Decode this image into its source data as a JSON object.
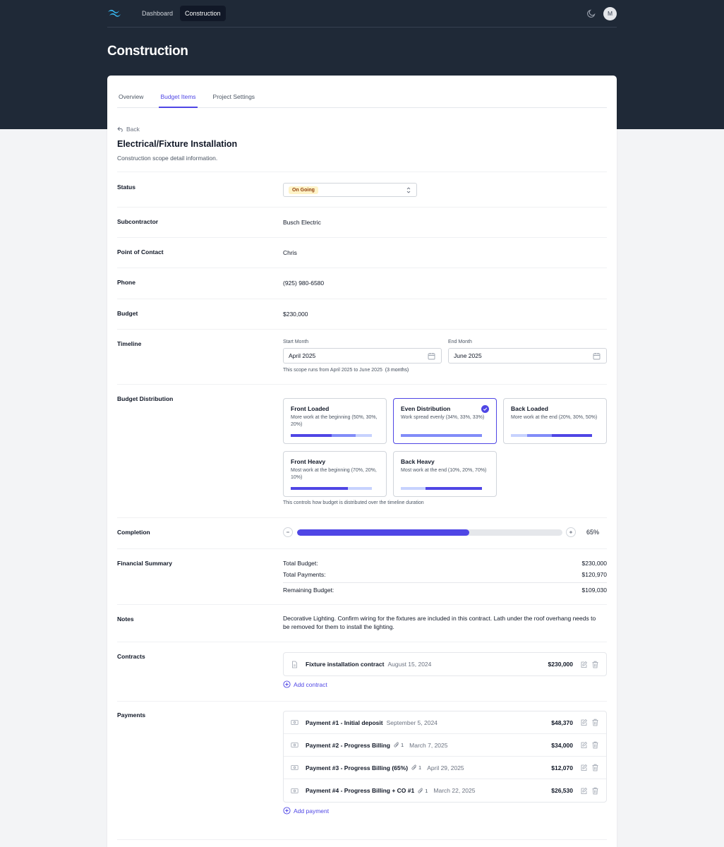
{
  "nav": {
    "links": [
      "Dashboard",
      "Construction"
    ],
    "avatar_initial": "M"
  },
  "page": {
    "title": "Construction"
  },
  "tabs": [
    "Overview",
    "Budget Items",
    "Project Settings"
  ],
  "detail": {
    "back_label": "Back",
    "title": "Electrical/Fixture Installation",
    "subtitle": "Construction scope detail information."
  },
  "fields": {
    "status": {
      "label": "Status",
      "value": "On Going"
    },
    "subcontractor": {
      "label": "Subcontractor",
      "value": "Busch Electric"
    },
    "contact": {
      "label": "Point of Contact",
      "value": "Chris"
    },
    "phone": {
      "label": "Phone",
      "value": "(925) 980-6580"
    },
    "budget": {
      "label": "Budget",
      "value": "$230,000"
    }
  },
  "timeline": {
    "label": "Timeline",
    "start_label": "Start Month",
    "start_value": "April 2025",
    "end_label": "End Month",
    "end_value": "June 2025",
    "hint_text": "This scope runs from April 2025 to June 2025",
    "hint_months": "(3 months)"
  },
  "distribution": {
    "label": "Budget Distribution",
    "hint": "This controls how budget is distributed over the timeline duration",
    "options": [
      {
        "title": "Front Loaded",
        "desc": "More work at the beginning (50%, 30%, 20%)",
        "split": [
          50,
          30,
          20
        ],
        "selected": false
      },
      {
        "title": "Even Distribution",
        "desc": "Work spread evenly (34%, 33%, 33%)",
        "split": [
          34,
          33,
          33
        ],
        "selected": true
      },
      {
        "title": "Back Loaded",
        "desc": "More work at the end (20%, 30%, 50%)",
        "split": [
          20,
          30,
          50
        ],
        "selected": false
      },
      {
        "title": "Front Heavy",
        "desc": "Most work at the beginning (70%, 20%, 10%)",
        "split": [
          70,
          20,
          10
        ],
        "selected": false
      },
      {
        "title": "Back Heavy",
        "desc": "Most work at the end (10%, 20%, 70%)",
        "split": [
          10,
          20,
          70
        ],
        "selected": false
      }
    ]
  },
  "completion": {
    "label": "Completion",
    "percent": 65,
    "percent_text": "65%"
  },
  "financial": {
    "label": "Financial Summary",
    "rows": [
      {
        "label": "Total Budget:",
        "value": "$230,000"
      },
      {
        "label": "Total Payments:",
        "value": "$120,970"
      },
      {
        "label": "Remaining Budget:",
        "value": "$109,030"
      }
    ]
  },
  "notes": {
    "label": "Notes",
    "text": "Decorative Lighting. Confirm wiring for the fixtures are included in this contract. Lath under the roof overhang needs to be removed for them to install the lighting."
  },
  "contracts": {
    "label": "Contracts",
    "items": [
      {
        "name": "Fixture installation contract",
        "date": "August 15, 2024",
        "amount": "$230,000"
      }
    ],
    "add_label": "Add contract"
  },
  "payments": {
    "label": "Payments",
    "items": [
      {
        "name": "Payment #1 - Initial deposit",
        "attachments": "",
        "date": "September 5, 2024",
        "amount": "$48,370"
      },
      {
        "name": "Payment #2 - Progress Billing",
        "attachments": "1",
        "date": "March 7, 2025",
        "amount": "$34,000"
      },
      {
        "name": "Payment #3 - Progress Billing (65%)",
        "attachments": "1",
        "date": "April 29, 2025",
        "amount": "$12,070"
      },
      {
        "name": "Payment #4 - Progress Billing + CO #1",
        "attachments": "1",
        "date": "March 22, 2025",
        "amount": "$26,530"
      }
    ],
    "add_label": "Add payment"
  },
  "colors": {
    "header_bg": "#1f2937",
    "accent": "#4f46e5",
    "accent_mid": "#818cf8",
    "accent_light": "#c7d2fe",
    "status_badge_bg": "#fef3c7"
  }
}
